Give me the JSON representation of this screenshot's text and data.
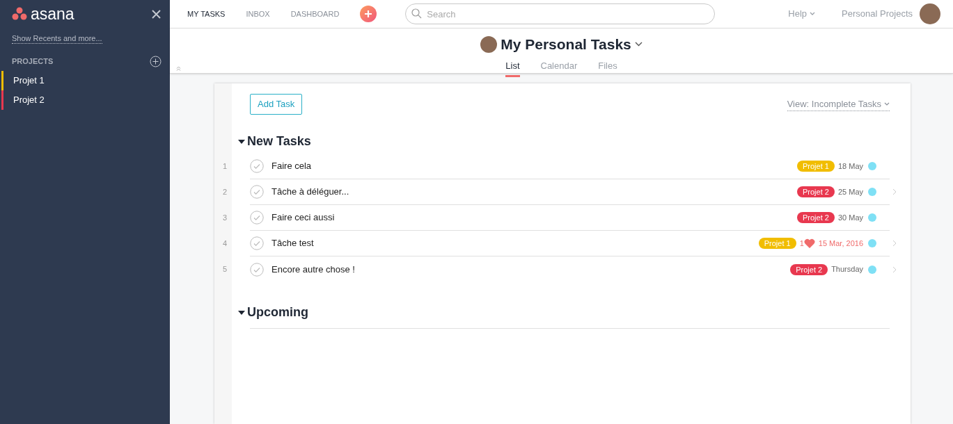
{
  "sidebar": {
    "logo": "asana",
    "recents_link": "Show Recents and more...",
    "projects_heading": "PROJECTS",
    "projects": [
      {
        "name": "Projet 1",
        "color": "#f1bd00"
      },
      {
        "name": "Projet 2",
        "color": "#e8384f"
      }
    ]
  },
  "topbar": {
    "nav": [
      {
        "label": "MY TASKS",
        "selected": true
      },
      {
        "label": "INBOX",
        "selected": false
      },
      {
        "label": "DASHBOARD",
        "selected": false
      }
    ],
    "search": {
      "placeholder": "Search"
    },
    "help": "Help",
    "workspace": "Personal Projects"
  },
  "header": {
    "title": "My Personal Tasks",
    "tabs": [
      {
        "label": "List",
        "selected": true
      },
      {
        "label": "Calendar",
        "selected": false
      },
      {
        "label": "Files",
        "selected": false
      }
    ]
  },
  "toolbar": {
    "add_button": "Add Task",
    "view_filter": "View: Incomplete Tasks"
  },
  "sections": [
    {
      "title": "New Tasks",
      "expanded": true,
      "tasks": [
        {
          "number": "1",
          "title": "Faire cela",
          "tag": {
            "label": "Projet 1",
            "color": "#f1bd00"
          },
          "due": "18 May",
          "overdue": false,
          "has_details": false
        },
        {
          "number": "2",
          "title": "Tâche à déléguer...",
          "tag": {
            "label": "Projet 2",
            "color": "#e8384f"
          },
          "due": "25 May",
          "overdue": false,
          "has_details": true
        },
        {
          "number": "3",
          "title": "Faire ceci aussi",
          "tag": {
            "label": "Projet 2",
            "color": "#e8384f"
          },
          "due": "30 May",
          "overdue": false,
          "has_details": false
        },
        {
          "number": "4",
          "title": "Tâche test",
          "tag": {
            "label": "Projet 1",
            "color": "#f1bd00"
          },
          "hearts": "1",
          "due": "15 Mar, 2016",
          "overdue": true,
          "has_details": true
        },
        {
          "number": "5",
          "title": "Encore autre chose !",
          "tag": {
            "label": "Projet 2",
            "color": "#e8384f"
          },
          "due": "Thursday",
          "overdue": false,
          "has_details": true
        }
      ]
    },
    {
      "title": "Upcoming",
      "expanded": true
    }
  ]
}
